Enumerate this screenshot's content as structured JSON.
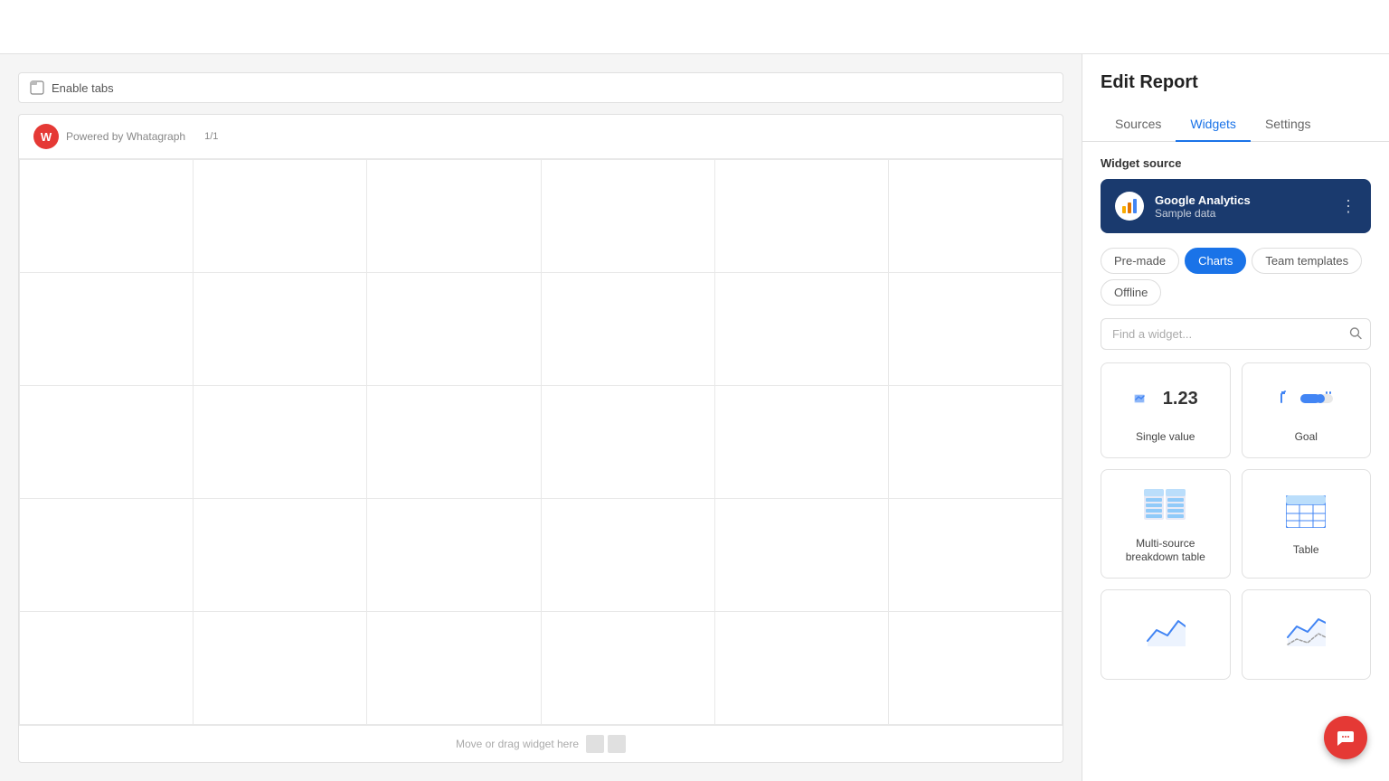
{
  "topBar": {
    "visible": true
  },
  "canvas": {
    "enableTabsLabel": "Enable tabs",
    "poweredByLabel": "Powered by Whatagraph",
    "logoLetter": "W",
    "pageIndicator": "1/1",
    "gridRows": 5,
    "gridCols": 6,
    "footerText": "Move or drag widget here"
  },
  "rightPanel": {
    "title": "Edit Report",
    "tabs": [
      {
        "id": "sources",
        "label": "Sources"
      },
      {
        "id": "widgets",
        "label": "Widgets"
      },
      {
        "id": "settings",
        "label": "Settings"
      }
    ],
    "activeTab": "widgets",
    "widgetSource": {
      "sectionTitle": "Widget source",
      "sourceName": "Google Analytics",
      "sourceSub": "Sample data",
      "moreIcon": "⋮"
    },
    "filterButtons": [
      {
        "id": "premade",
        "label": "Pre-made",
        "active": false
      },
      {
        "id": "charts",
        "label": "Charts",
        "active": true
      },
      {
        "id": "teamTemplates",
        "label": "Team templates",
        "active": false
      },
      {
        "id": "offline",
        "label": "Offline",
        "active": false
      }
    ],
    "search": {
      "placeholder": "Find a widget..."
    },
    "widgets": [
      {
        "id": "single-value",
        "label": "Single value",
        "iconType": "single-value"
      },
      {
        "id": "goal",
        "label": "Goal",
        "iconType": "goal"
      },
      {
        "id": "multi-source",
        "label": "Multi-source breakdown table",
        "iconType": "multi-source"
      },
      {
        "id": "table",
        "label": "Table",
        "iconType": "table"
      },
      {
        "id": "line-chart-1",
        "label": "",
        "iconType": "line-chart"
      },
      {
        "id": "line-chart-2",
        "label": "",
        "iconType": "line-chart-2"
      }
    ]
  }
}
